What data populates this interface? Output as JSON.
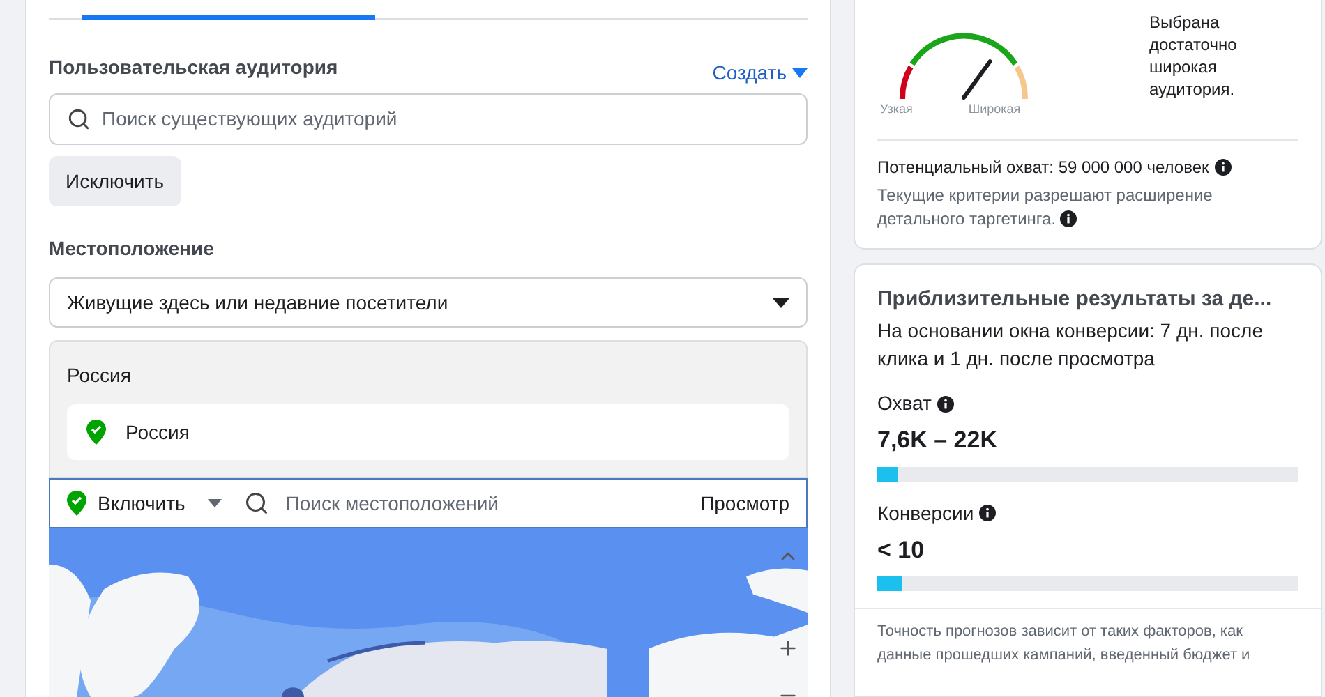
{
  "custom_audience": {
    "label": "Пользовательская аудитория",
    "create_link": "Создать",
    "search": {
      "placeholder": "Поиск существующих аудиторий"
    },
    "exclude_button": "Исключить"
  },
  "location": {
    "label": "Местоположение",
    "dropdown": "Живущие здесь или недавние посетители",
    "group_title": "Россия",
    "items": [
      {
        "name": "Россия"
      }
    ],
    "include_button": "Включить",
    "search": {
      "placeholder": "Поиск местоположений"
    },
    "browse_button": "Просмотр"
  },
  "audience_size": {
    "gauge_left": "Узкая",
    "gauge_right": "Широкая",
    "verdict": "Выбрана достаточно широкая аудитория.",
    "potential_reach": "Потенциальный охват: 59 000 000 человек",
    "note": "Текущие критерии разрешают расширение детального таргетинга."
  },
  "estimates": {
    "title": "Приблизительные результаты за де...",
    "subtitle": "На основании окна конверсии: 7 дн. после клика и 1 дн. после просмотра",
    "metrics": [
      {
        "label": "Охват",
        "value": "7,6K – 22K",
        "level": 0.05
      },
      {
        "label": "Конверсии",
        "value": "< 10",
        "level": 0.06
      }
    ],
    "footer": "Точность прогнозов зависит от таких факторов, как данные прошедших кампаний, введенный бюджет и"
  }
}
